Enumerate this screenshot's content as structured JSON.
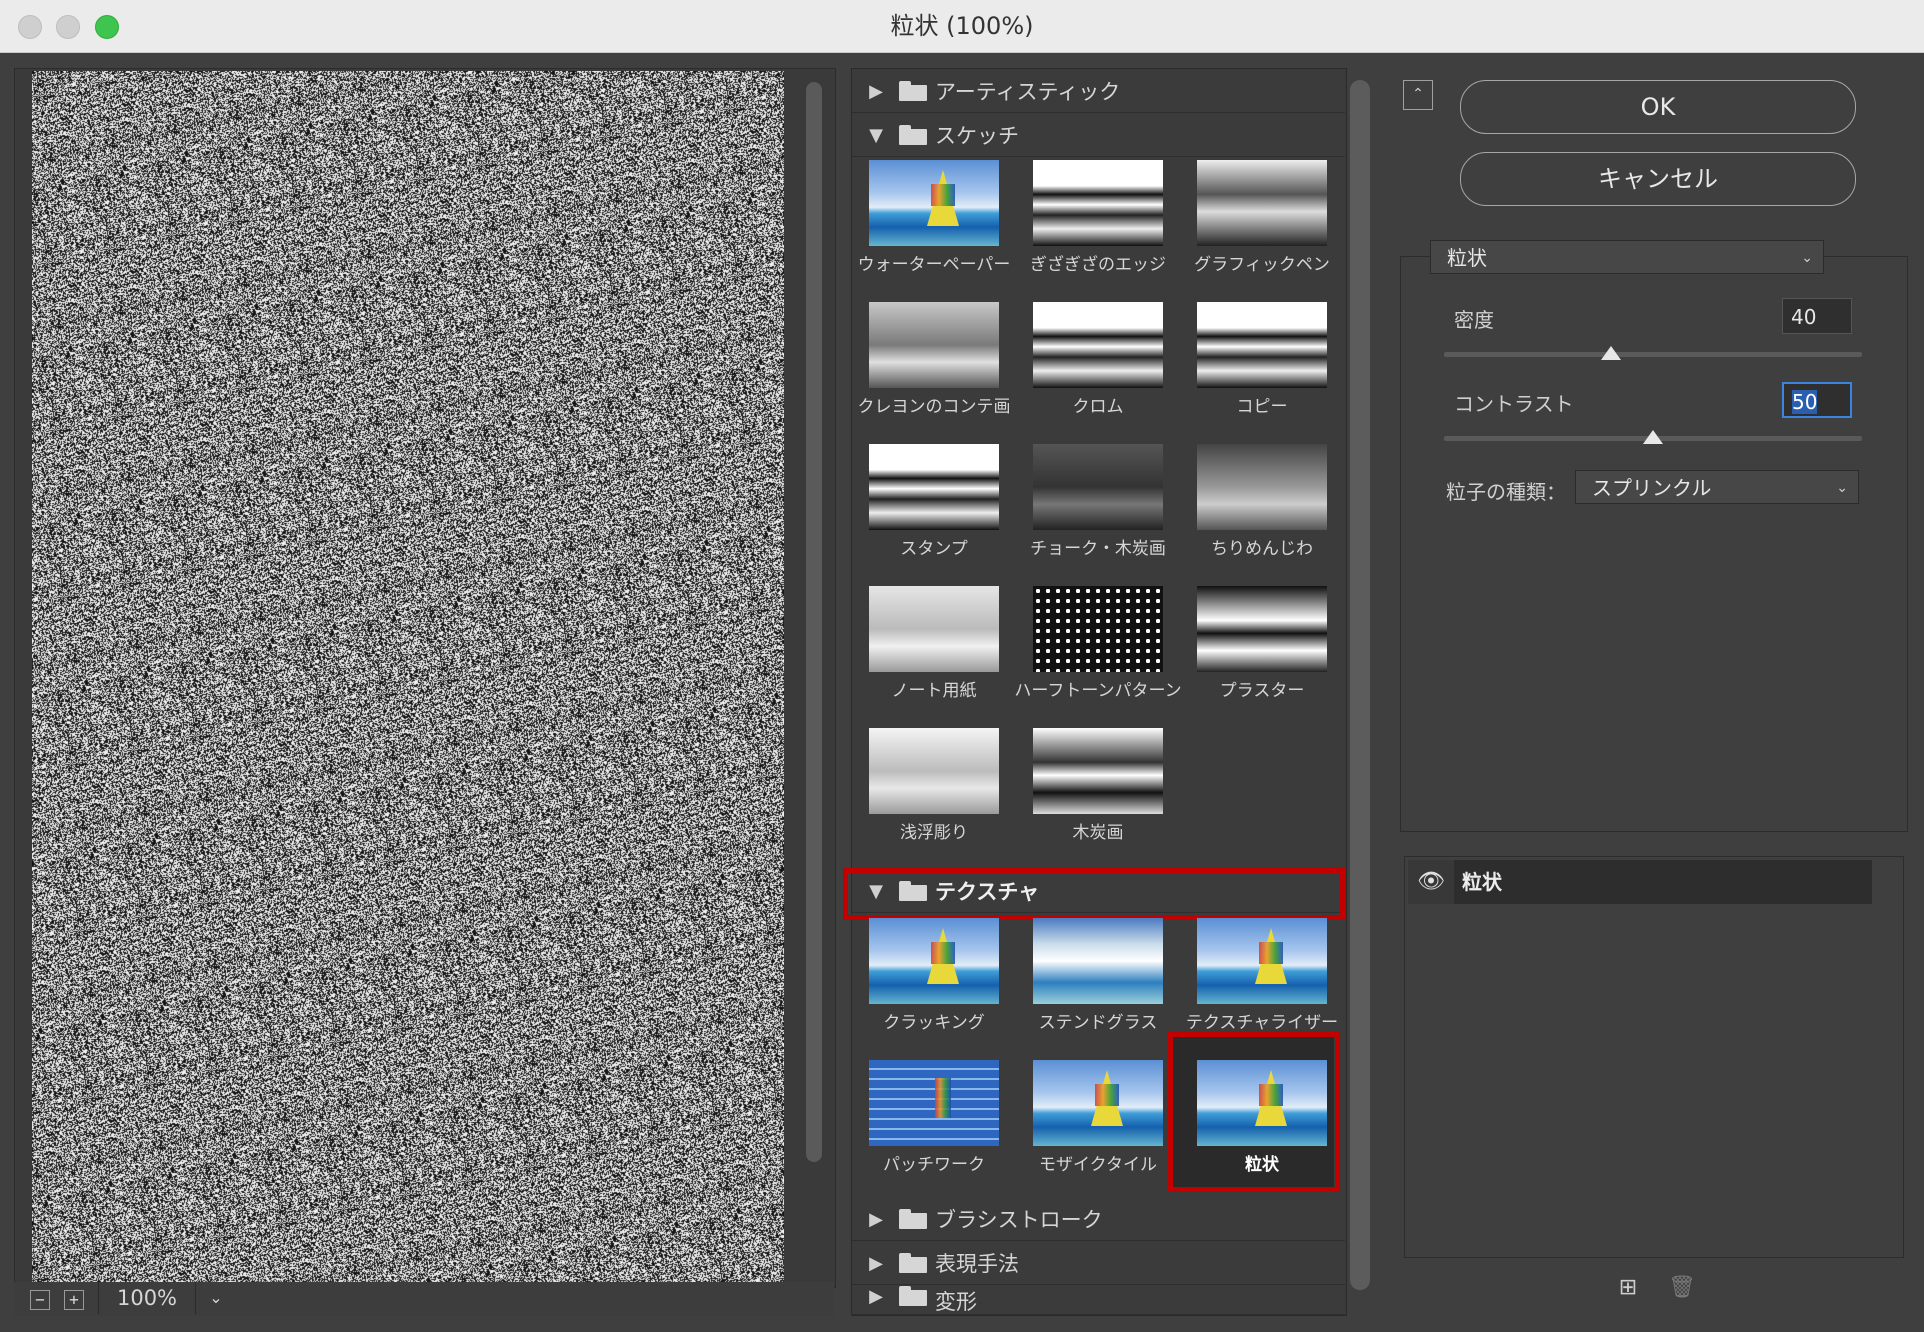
{
  "window": {
    "title": "粒状 (100%)"
  },
  "preview": {
    "zoom": "100%",
    "zoom_out_symbol": "−",
    "zoom_in_symbol": "+"
  },
  "gallery": {
    "categories": [
      {
        "label": "アーティスティック",
        "expanded": false
      },
      {
        "label": "スケッチ",
        "expanded": true,
        "filters": [
          "ウォーターペーパー",
          "ぎざぎざのエッジ",
          "グラフィックペン",
          "クレヨンのコンテ画",
          "クロム",
          "コピー",
          "スタンプ",
          "チョーク・木炭画",
          "ちりめんじわ",
          "ノート用紙",
          "ハーフトーンパターン",
          "プラスター",
          "浅浮彫り",
          "木炭画"
        ]
      },
      {
        "label": "テクスチャ",
        "expanded": true,
        "highlighted": true,
        "filters": [
          "クラッキング",
          "ステンドグラス",
          "テクスチャライザー",
          "パッチワーク",
          "モザイクタイル",
          "粒状"
        ]
      },
      {
        "label": "ブラシストローク",
        "expanded": false
      },
      {
        "label": "表現手法",
        "expanded": false
      },
      {
        "label": "変形",
        "expanded": false
      }
    ],
    "selected_filter": "粒状"
  },
  "buttons": {
    "ok": "OK",
    "cancel": "キャンセル"
  },
  "settings": {
    "filter": "粒状",
    "density_label": "密度",
    "density_value": "40",
    "density_fraction": 0.4,
    "contrast_label": "コントラスト",
    "contrast_value": "50",
    "contrast_fraction": 0.5,
    "grain_type_label": "粒子の種類：",
    "grain_type_value": "スプリンクル"
  },
  "layers": [
    {
      "name": "粒状",
      "visible": true
    }
  ],
  "colors": {
    "highlight_red": "#c30000",
    "focus_blue": "#3b84e0",
    "traffic_green": "#3ec44f"
  }
}
